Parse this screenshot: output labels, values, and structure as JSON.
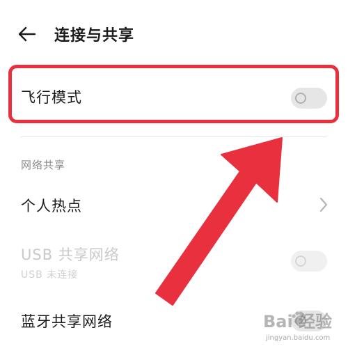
{
  "header": {
    "title": "连接与共享",
    "back_icon": "arrow-left-icon"
  },
  "airplane_mode": {
    "label": "飞行模式",
    "enabled": false
  },
  "network_sharing": {
    "section_title": "网络共享",
    "items": [
      {
        "label": "个人热点",
        "icon": "chevron-right-icon"
      },
      {
        "label": "USB 共享网络",
        "subtitle": "USB 未连接",
        "enabled": false,
        "disabled": true
      },
      {
        "label": "蓝牙共享网络",
        "enabled": false
      }
    ]
  },
  "annotation": {
    "color": "#e8303e"
  },
  "watermark": {
    "main": "Bai 经验",
    "sub": "jingyan.baidu.com"
  }
}
